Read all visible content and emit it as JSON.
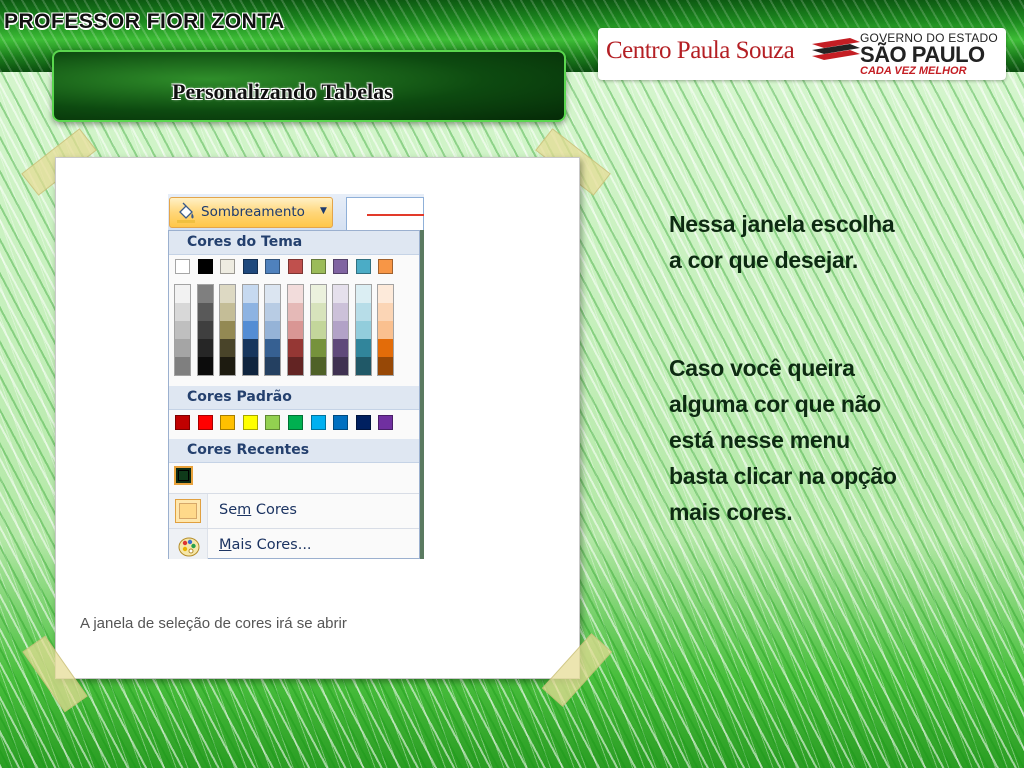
{
  "header": {
    "professor": "PROFESSOR FIORI ZONTA",
    "slide_title": "Personalizando Tabelas",
    "logo_left": "Centro Paula Souza",
    "gov_line": "GOVERNO DO ESTADO",
    "state_line": "SÃO PAULO",
    "motto_line": "CADA VEZ MELHOR"
  },
  "screenshot": {
    "shading_button_label": "Sombreamento",
    "sections": {
      "theme": "Cores do Tema",
      "standard": "Cores Padrão",
      "recent": "Cores Recentes"
    },
    "theme_top_row": [
      "#ffffff",
      "#000000",
      "#eeece1",
      "#1f497d",
      "#4f81bd",
      "#c0504d",
      "#9bbb59",
      "#8064a2",
      "#4bacc6",
      "#f79646"
    ],
    "theme_shades": [
      [
        "#f2f2f2",
        "#d8d8d8",
        "#bfbfbf",
        "#a5a5a5",
        "#7f7f7f"
      ],
      [
        "#7f7f7f",
        "#595959",
        "#3f3f3f",
        "#262626",
        "#0c0c0c"
      ],
      [
        "#ddd9c3",
        "#c4bd97",
        "#938953",
        "#494429",
        "#1d1b10"
      ],
      [
        "#c6d9f0",
        "#8db3e2",
        "#548dd4",
        "#17365d",
        "#0f243e"
      ],
      [
        "#dbe5f1",
        "#b8cce4",
        "#95b3d7",
        "#366092",
        "#244061"
      ],
      [
        "#f2dcdb",
        "#e5b9b7",
        "#d99694",
        "#953734",
        "#632423"
      ],
      [
        "#ebf1dd",
        "#d7e3bc",
        "#c3d69b",
        "#76923c",
        "#4f6128"
      ],
      [
        "#e5e0ec",
        "#ccc1d9",
        "#b2a2c7",
        "#5f497a",
        "#3f3151"
      ],
      [
        "#dbeef3",
        "#b7dde8",
        "#92cddc",
        "#31859b",
        "#205867"
      ],
      [
        "#fdeada",
        "#fbd5b5",
        "#fac08f",
        "#e36c09",
        "#974806"
      ]
    ],
    "standard_colors": [
      "#c00000",
      "#ff0000",
      "#ffc000",
      "#ffff00",
      "#92d050",
      "#00b050",
      "#00b0f0",
      "#0070c0",
      "#002060",
      "#7030a0"
    ],
    "recent_color": "#0f3a1a",
    "no_color_label_pre": "Se",
    "no_color_label_key": "m",
    "no_color_label_post": " Cores",
    "more_colors_label_key": "M",
    "more_colors_label_post": "ais Cores..."
  },
  "caption": "A janela de seleção de cores irá se abrir",
  "body": {
    "paragraph_1": "Nessa janela escolha\na cor que desejar.",
    "paragraph_2": "Caso você queira\nalguma cor que não\nestá nesse menu\nbasta clicar na opção\nmais cores."
  }
}
